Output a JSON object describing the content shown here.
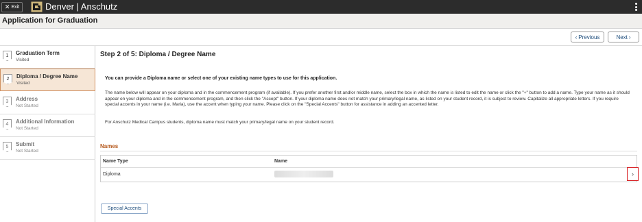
{
  "topbar": {
    "exit_label": "Exit",
    "brand": "Denver | Anschutz",
    "logo_icon": "cu-logo-icon",
    "menu_icon": "kebab-menu-icon"
  },
  "page": {
    "title": "Application for Graduation"
  },
  "nav": {
    "previous_label": "Previous",
    "next_label": "Next"
  },
  "steps": [
    {
      "number": "1",
      "name": "Graduation Term",
      "status": "Visited"
    },
    {
      "number": "2",
      "name": "Diploma / Degree Name",
      "status": "Visited"
    },
    {
      "number": "3",
      "name": "Address",
      "status": "Not Started"
    },
    {
      "number": "4",
      "name": "Additional Information",
      "status": "Not Started"
    },
    {
      "number": "5",
      "name": "Submit",
      "status": "Not Started"
    }
  ],
  "main": {
    "heading": "Step 2 of 5: Diploma / Degree Name",
    "intro": "You can provide a Diploma name or select one of your existing name types to use for this application.",
    "para1": "The name below will appear on your diploma and in the commencement program (if available). If you prefer another first and/or middle name, select the box in which the name is listed to edit the name or click the \"+\" button to add a name. Type your name as it should appear on your diploma and in the commencement program, and then click the \"Accept\" button. If your diploma name does not match your primary/legal name, as listed on your student record, it is subject to review. Capitalize all appropriate letters. If you require special accents in your name (i.e. Maria), use the accent when typing your name. Please click on the \"Special Accents\" button for assistance in adding an accented letter.",
    "para2": "For Anschutz Medical Campus students, diploma name must match your primary/legal name on your student record.",
    "names_heading": "Names",
    "table": {
      "col_type": "Name Type",
      "col_name": "Name",
      "rows": [
        {
          "type": "Diploma",
          "name": ""
        }
      ]
    },
    "special_accents_label": "Special Accents"
  },
  "colors": {
    "topbar": "#2c2c2c",
    "active_step_bg": "#f6e6d6",
    "section_heading": "#b5581b",
    "highlight_border": "#d9262a",
    "button_text": "#1a4a7a"
  }
}
